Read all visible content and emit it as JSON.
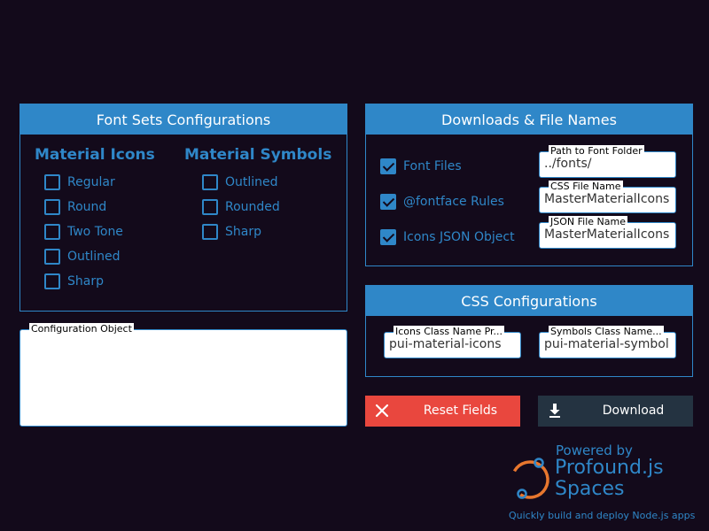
{
  "font_sets": {
    "title": "Font Sets Configurations",
    "material_icons": {
      "heading": "Material Icons",
      "options": [
        {
          "label": "Regular",
          "checked": false
        },
        {
          "label": "Round",
          "checked": false
        },
        {
          "label": "Two Tone",
          "checked": false
        },
        {
          "label": "Outlined",
          "checked": false
        },
        {
          "label": "Sharp",
          "checked": false
        }
      ]
    },
    "material_symbols": {
      "heading": "Material Symbols",
      "options": [
        {
          "label": "Outlined",
          "checked": false
        },
        {
          "label": "Rounded",
          "checked": false
        },
        {
          "label": "Sharp",
          "checked": false
        }
      ]
    }
  },
  "downloads": {
    "title": "Downloads & File Names",
    "rows": [
      {
        "label": "Font Files",
        "checked": true,
        "field_label": "Path to Font Folder",
        "field_value": "../fonts/"
      },
      {
        "label": "@fontface Rules",
        "checked": true,
        "field_label": "CSS File Name",
        "field_value": "MasterMaterialIcons"
      },
      {
        "label": "Icons JSON Object",
        "checked": true,
        "field_label": "JSON File Name",
        "field_value": "MasterMaterialIcons"
      }
    ]
  },
  "css_config": {
    "title": "CSS Configurations",
    "icons_prefix": {
      "label": "Icons Class Name Pr...",
      "value": "pui-material-icons"
    },
    "symbols_prefix": {
      "label": "Symbols Class Name...",
      "value": "pui-material-symbol"
    }
  },
  "config_object": {
    "label": "Configuration Object",
    "value": ""
  },
  "buttons": {
    "reset": "Reset Fields",
    "download": "Download"
  },
  "brand": {
    "powered_by": "Powered by",
    "name_line1": "Profound.js",
    "name_line2": "Spaces",
    "tagline": "Quickly build and deploy Node.js apps"
  },
  "colors": {
    "background": "#130a1b",
    "accent": "#2f87c8",
    "reset": "#e9473e",
    "download": "#243341",
    "logo_orange": "#e8772e"
  }
}
